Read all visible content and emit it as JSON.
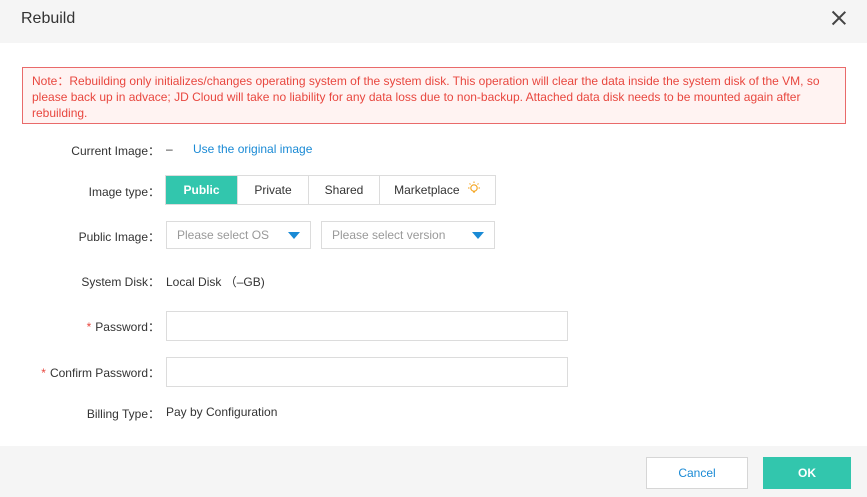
{
  "dialog": {
    "title": "Rebuild"
  },
  "note": {
    "text": "Note：Rebuilding only initializes/changes operating system of the system disk. This operation will clear the data inside the system disk of the VM, so please back up in advace; JD Cloud will take no liability for any data loss due to non-backup. Attached data disk needs to be mounted again after rebuilding."
  },
  "form": {
    "current_image": {
      "label": "Current Image：",
      "value": "–",
      "link": "Use the original image"
    },
    "image_type": {
      "label": "Image type：",
      "options": [
        "Public",
        "Private",
        "Shared",
        "Marketplace"
      ],
      "selected": "Public"
    },
    "public_image": {
      "label": "Public Image：",
      "os_placeholder": "Please select OS",
      "version_placeholder": "Please select version"
    },
    "system_disk": {
      "label": "System Disk：",
      "value": "Local Disk （–GB)"
    },
    "password": {
      "required_mark": "*",
      "label": "Password：",
      "value": ""
    },
    "confirm_password": {
      "required_mark": "*",
      "label": "Confirm Password：",
      "value": ""
    },
    "billing_type": {
      "label": "Billing Type：",
      "value": "Pay by Configuration"
    }
  },
  "footer": {
    "cancel_label": "Cancel",
    "ok_label": "OK"
  },
  "colors": {
    "accent": "#32c6ad",
    "link": "#1a8ad5",
    "warning_text": "#e8473f",
    "warning_bg": "#fff3f2",
    "warning_border": "#e96a6a"
  }
}
